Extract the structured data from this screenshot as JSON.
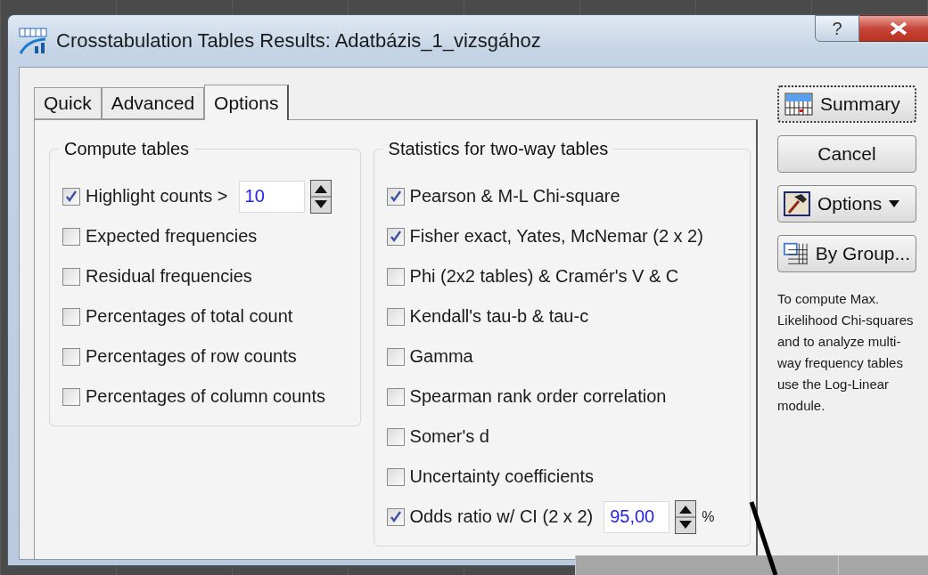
{
  "window": {
    "title": "Crosstabulation Tables Results: Adatbázis_1_vizsgához",
    "help_button": "?"
  },
  "tabs": [
    {
      "label": "Quick",
      "selected": false
    },
    {
      "label": "Advanced",
      "selected": false
    },
    {
      "label": "Options",
      "selected": true
    }
  ],
  "compute_tables": {
    "title": "Compute tables",
    "items": [
      {
        "label": "Highlight counts >",
        "checked": true,
        "value": "10"
      },
      {
        "label": "Expected frequencies",
        "checked": false
      },
      {
        "label": "Residual frequencies",
        "checked": false
      },
      {
        "label": "Percentages of total count",
        "checked": false
      },
      {
        "label": "Percentages of row counts",
        "checked": false
      },
      {
        "label": "Percentages of column counts",
        "checked": false
      }
    ]
  },
  "statistics": {
    "title": "Statistics for two-way tables",
    "items": [
      {
        "label": "Pearson & M-L Chi-square",
        "checked": true
      },
      {
        "label": "Fisher exact, Yates, McNemar (2 x 2)",
        "checked": true
      },
      {
        "label": "Phi (2x2 tables) & Cramér's V &  C",
        "checked": false
      },
      {
        "label": "Kendall's tau-b & tau-c",
        "checked": false
      },
      {
        "label": "Gamma",
        "checked": false
      },
      {
        "label": "Spearman rank order correlation",
        "checked": false
      },
      {
        "label": "Somer's d",
        "checked": false
      },
      {
        "label": "Uncertainty coefficients",
        "checked": false
      },
      {
        "label": "Odds ratio w/ CI (2 x 2)",
        "checked": true,
        "value": "95,00",
        "unit": "%"
      }
    ]
  },
  "buttons": [
    {
      "label": "Summary",
      "kind": "summary"
    },
    {
      "label": "Cancel",
      "kind": "plain"
    },
    {
      "label": "Options",
      "kind": "menu"
    },
    {
      "label": "By Group...",
      "kind": "group"
    }
  ],
  "note": "To compute Max. Likelihood Chi-squares and to analyze multi-way frequency tables use the Log-Linear module."
}
